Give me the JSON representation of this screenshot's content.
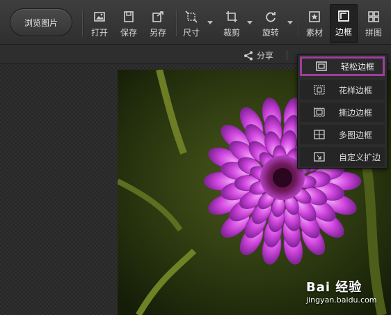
{
  "toolbar": {
    "browse_label": "浏览图片",
    "tools": [
      {
        "id": "open",
        "label": "打开",
        "icon": "image-open-icon"
      },
      {
        "id": "save",
        "label": "保存",
        "icon": "save-icon"
      },
      {
        "id": "saveas",
        "label": "另存",
        "icon": "save-as-icon"
      },
      {
        "id": "size",
        "label": "尺寸",
        "icon": "resize-icon"
      },
      {
        "id": "crop",
        "label": "裁剪",
        "icon": "crop-icon"
      },
      {
        "id": "rotate",
        "label": "旋转",
        "icon": "rotate-icon"
      },
      {
        "id": "material",
        "label": "素材",
        "icon": "star-frame-icon"
      },
      {
        "id": "border",
        "label": "边框",
        "icon": "border-frame-icon"
      },
      {
        "id": "collage",
        "label": "拼图",
        "icon": "grid-icon"
      }
    ],
    "active_tool": "border"
  },
  "subbar": {
    "share_label": "分享"
  },
  "border_menu": {
    "items": [
      {
        "label": "轻松边框",
        "icon": "simple-frame-icon",
        "selected": true
      },
      {
        "label": "花样边框",
        "icon": "pattern-frame-icon",
        "selected": false
      },
      {
        "label": "撕边边框",
        "icon": "torn-frame-icon",
        "selected": false
      },
      {
        "label": "多图边框",
        "icon": "multi-frame-icon",
        "selected": false
      },
      {
        "label": "自定义扩边",
        "icon": "custom-expand-icon",
        "selected": false
      }
    ],
    "highlight_color": "#9b3f9b"
  },
  "watermark": {
    "brand": "Bai  经验",
    "url": "jingyan.baidu.com"
  },
  "colors": {
    "toolbar_bg": "#353535",
    "flower": "#c83ad8",
    "leaves": "#3a4a18"
  }
}
